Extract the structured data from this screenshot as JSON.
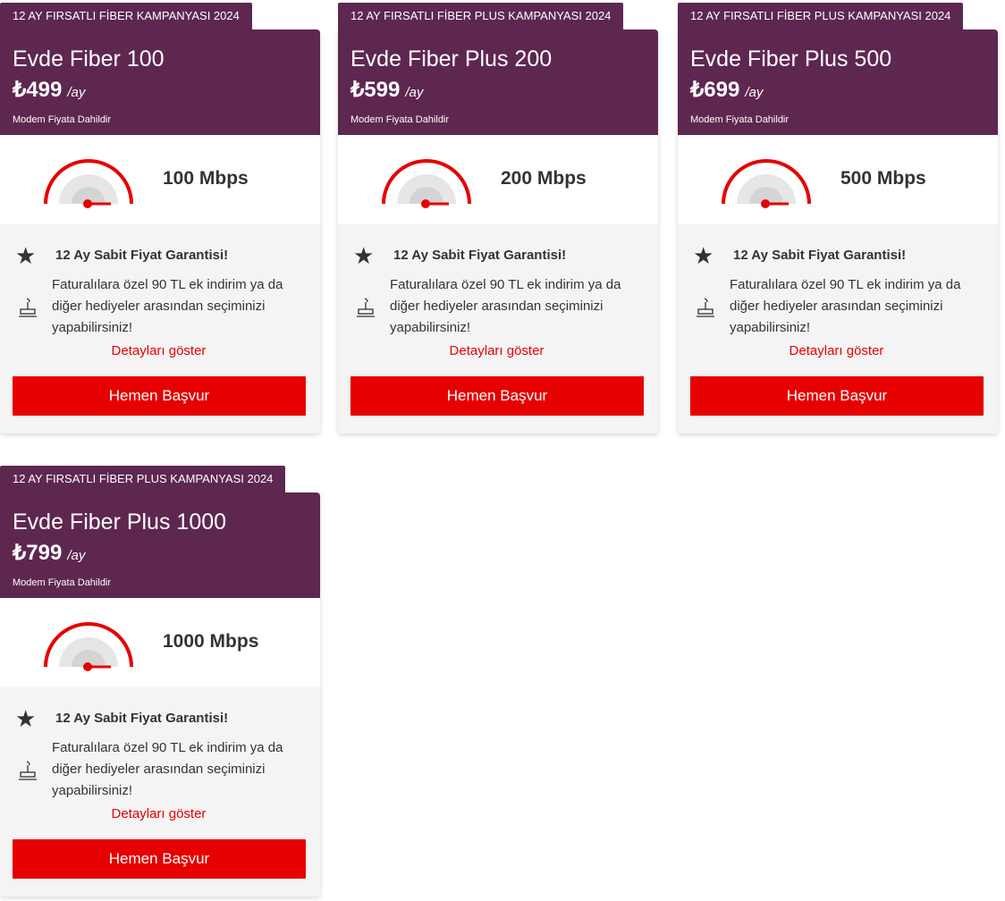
{
  "colors": {
    "brand_purple": "#5e2750",
    "accent_red": "#e60000",
    "panel_grey": "#f4f4f4"
  },
  "cards": [
    {
      "campaign": "12 AY FIRSATLI FİBER KAMPANYASI 2024",
      "name": "Evde Fiber 100",
      "price": "₺499",
      "period": "/ay",
      "modem_note": "Modem Fiyata Dahildir",
      "speed": "100 Mbps",
      "guarantee": "12 Ay Sabit Fiyat Garantisi!",
      "description": "Faturalılara özel 90 TL ek indirim ya da diğer hediyeler arasından seçiminizi yapabilirsiniz!",
      "details_link": "Detayları göster",
      "apply_button": "Hemen Başvur"
    },
    {
      "campaign": "12 AY FIRSATLI FİBER PLUS KAMPANYASI 2024",
      "name": "Evde Fiber Plus 200",
      "price": "₺599",
      "period": "/ay",
      "modem_note": "Modem Fiyata Dahildir",
      "speed": "200 Mbps",
      "guarantee": "12 Ay Sabit Fiyat Garantisi!",
      "description": "Faturalılara özel 90 TL ek indirim ya da diğer hediyeler arasından seçiminizi yapabilirsiniz!",
      "details_link": "Detayları göster",
      "apply_button": "Hemen Başvur"
    },
    {
      "campaign": "12 AY FIRSATLI FİBER PLUS KAMPANYASI 2024",
      "name": "Evde Fiber Plus 500",
      "price": "₺699",
      "period": "/ay",
      "modem_note": "Modem Fiyata Dahildir",
      "speed": "500 Mbps",
      "guarantee": "12 Ay Sabit Fiyat Garantisi!",
      "description": "Faturalılara özel 90 TL ek indirim ya da diğer hediyeler arasından seçiminizi yapabilirsiniz!",
      "details_link": "Detayları göster",
      "apply_button": "Hemen Başvur"
    },
    {
      "campaign": "12 AY FIRSATLI FİBER PLUS KAMPANYASI 2024",
      "name": "Evde Fiber Plus 1000",
      "price": "₺799",
      "period": "/ay",
      "modem_note": "Modem Fiyata Dahildir",
      "speed": "1000 Mbps",
      "guarantee": "12 Ay Sabit Fiyat Garantisi!",
      "description": "Faturalılara özel 90 TL ek indirim ya da diğer hediyeler arasından seçiminizi yapabilirsiniz!",
      "details_link": "Detayları göster",
      "apply_button": "Hemen Başvur"
    }
  ],
  "icons": {
    "gauge": "speedometer-icon",
    "star": "star-icon",
    "router": "router-icon"
  }
}
